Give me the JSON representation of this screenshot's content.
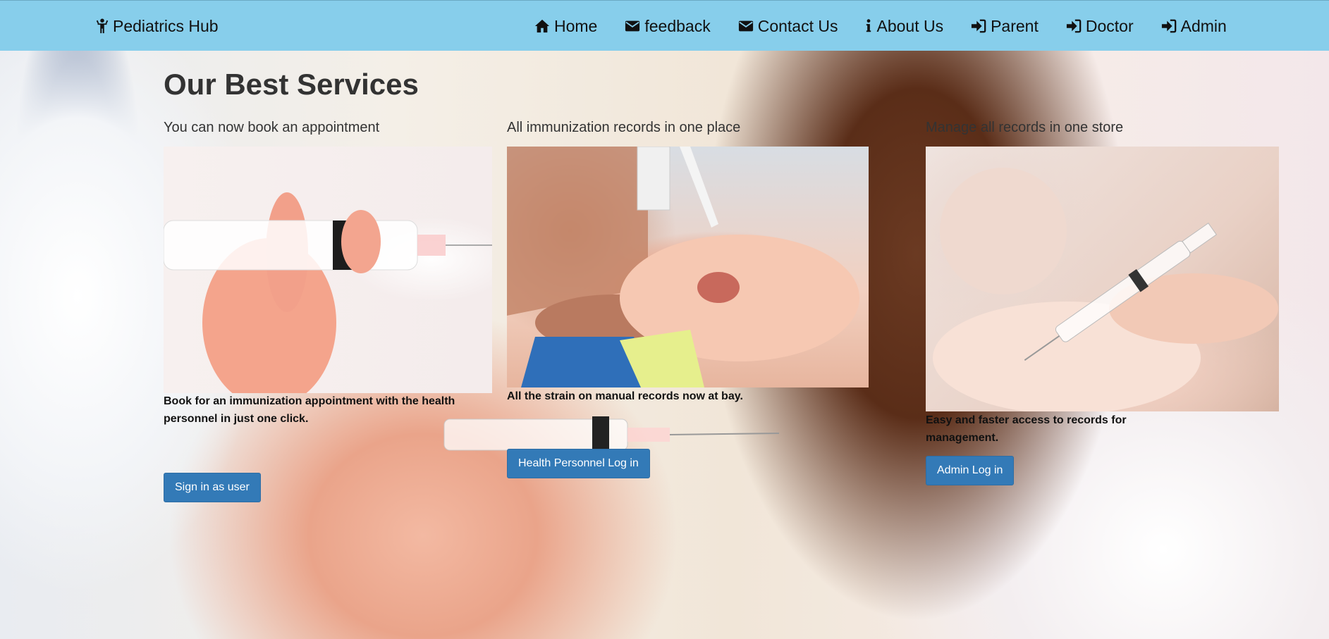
{
  "navbar": {
    "brand": "Pediatrics Hub",
    "brand_icon": "child-icon",
    "bg_color": "#87ceeb",
    "links": [
      {
        "label": "Home",
        "icon": "home-icon"
      },
      {
        "label": "feedback",
        "icon": "envelope-icon"
      },
      {
        "label": "Contact Us",
        "icon": "envelope-icon"
      },
      {
        "label": "About Us",
        "icon": "info-icon"
      },
      {
        "label": "Parent",
        "icon": "sign-in-icon"
      },
      {
        "label": "Doctor",
        "icon": "sign-in-icon"
      },
      {
        "label": "Admin",
        "icon": "sign-in-icon"
      }
    ]
  },
  "main": {
    "title": "Our Best Services",
    "services": [
      {
        "title": "You can now book an appointment",
        "description": "Book for an immunization appointment with the health personnel in just one click.",
        "button": "Sign in as user"
      },
      {
        "title": "All immunization records in one place",
        "description": "All the strain on manual records now at bay.",
        "button": "Health Personnel Log in"
      },
      {
        "title": "Manage all records in one store",
        "description": "Easy and faster access to records for management.",
        "button": "Admin Log in"
      }
    ]
  },
  "colors": {
    "button": "#337ab7",
    "text_dark": "#333333"
  }
}
